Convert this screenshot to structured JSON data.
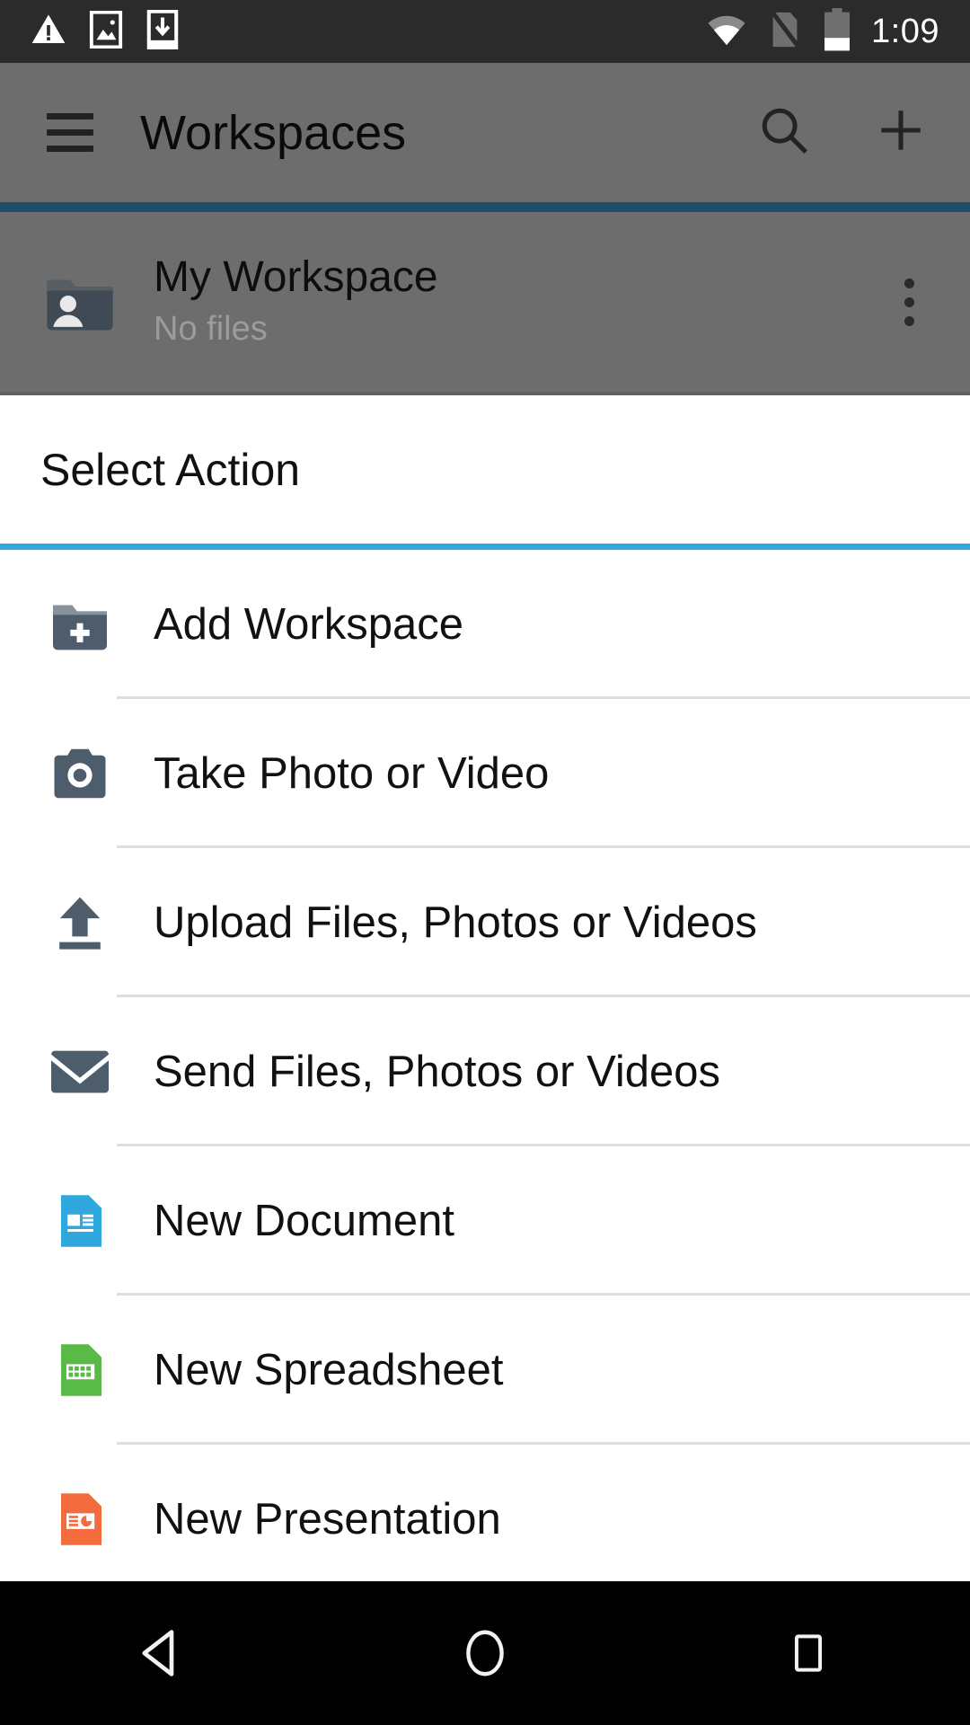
{
  "status_bar": {
    "time": "1:09",
    "left_icons": [
      "warning-triangle-icon",
      "image-icon",
      "download-to-device-icon"
    ],
    "right_icons": [
      "wifi-icon",
      "no-sim-card-icon",
      "battery-low-icon"
    ],
    "background_color": "#2b2b2b"
  },
  "app_bar": {
    "menu_icon": "hamburger-menu-icon",
    "title": "Workspaces",
    "search_icon": "search-icon",
    "add_icon": "plus-icon",
    "accent_color": "#1d4f68",
    "background_color": "#6d6d6d"
  },
  "workspace_row": {
    "icon": "folder-person-icon",
    "title": "My Workspace",
    "subtitle": "No files",
    "overflow_icon": "more-vertical-icon"
  },
  "dialog": {
    "title": "Select Action",
    "accent_color": "#33a8d8",
    "actions": [
      {
        "label": "Add Workspace",
        "icon": "folder-add-icon",
        "icon_color": "#4e5d6c"
      },
      {
        "label": "Take Photo or Video",
        "icon": "camera-icon",
        "icon_color": "#4e5d6c"
      },
      {
        "label": "Upload Files, Photos or Videos",
        "icon": "upload-arrow-icon",
        "icon_color": "#4e5d6c"
      },
      {
        "label": "Send Files, Photos or Videos",
        "icon": "envelope-icon",
        "icon_color": "#4e5d6c"
      },
      {
        "label": "New Document",
        "icon": "google-docs-icon",
        "icon_color": "#2fa8dd"
      },
      {
        "label": "New Spreadsheet",
        "icon": "google-sheets-icon",
        "icon_color": "#5aba47"
      },
      {
        "label": "New Presentation",
        "icon": "google-slides-icon",
        "icon_color": "#f26c3d"
      }
    ]
  },
  "nav_bar": {
    "back_label": "back-button",
    "home_label": "home-button",
    "recents_label": "recents-button"
  }
}
